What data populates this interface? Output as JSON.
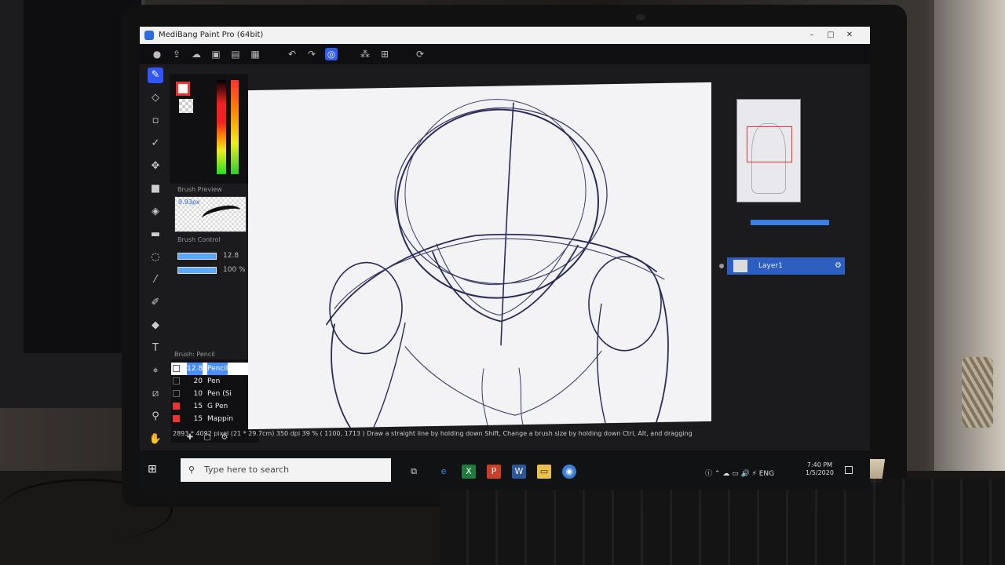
{
  "window": {
    "title": "MediBang Paint Pro (64bit)"
  },
  "toolbar": {
    "icons": [
      "brush-tool-icon",
      "share-icon",
      "cloud-icon",
      "team-icon",
      "new-file-icon",
      "grid-icon",
      "undo-icon",
      "redo-icon",
      "select-icon"
    ]
  },
  "brush_preview": {
    "title": "Brush Preview",
    "size_label": "9.93px"
  },
  "brush_control": {
    "title": "Brush Control",
    "size_value": "12.8",
    "opacity_value": "100 %"
  },
  "brush_list": {
    "title": "Brush: Pencil",
    "items": [
      {
        "size": "12.8",
        "name": "Pencil",
        "selected": true
      },
      {
        "size": "20",
        "name": "Pen",
        "selected": false
      },
      {
        "size": "10",
        "name": "Pen (Si",
        "selected": false
      },
      {
        "size": "15",
        "name": "G Pen",
        "selected": false
      },
      {
        "size": "15",
        "name": "Mappin",
        "selected": false
      }
    ]
  },
  "layers": {
    "layer_name": "Layer1"
  },
  "status": {
    "text": "2893 * 4092 pixel (21 * 29.7cm)  350 dpi  39 %  ( 1100, 1713 )  Draw a straight line by holding down Shift, Change a brush size by holding down Ctrl, Alt, and dragging"
  },
  "taskbar": {
    "search_placeholder": "Type here to search",
    "apps": [
      "edge-icon",
      "excel-icon",
      "powerpoint-icon",
      "word-icon",
      "file-explorer-icon",
      "medibang-icon"
    ],
    "tray_lang": "ENG",
    "clock_time": "7:40 PM",
    "clock_date": "1/5/2020"
  },
  "colors": {
    "accent": "#3156ff",
    "layer_selected": "#2c5fc0",
    "canvas_bg": "#f3f3f5",
    "sketch_ink": "#2a2a5a"
  }
}
